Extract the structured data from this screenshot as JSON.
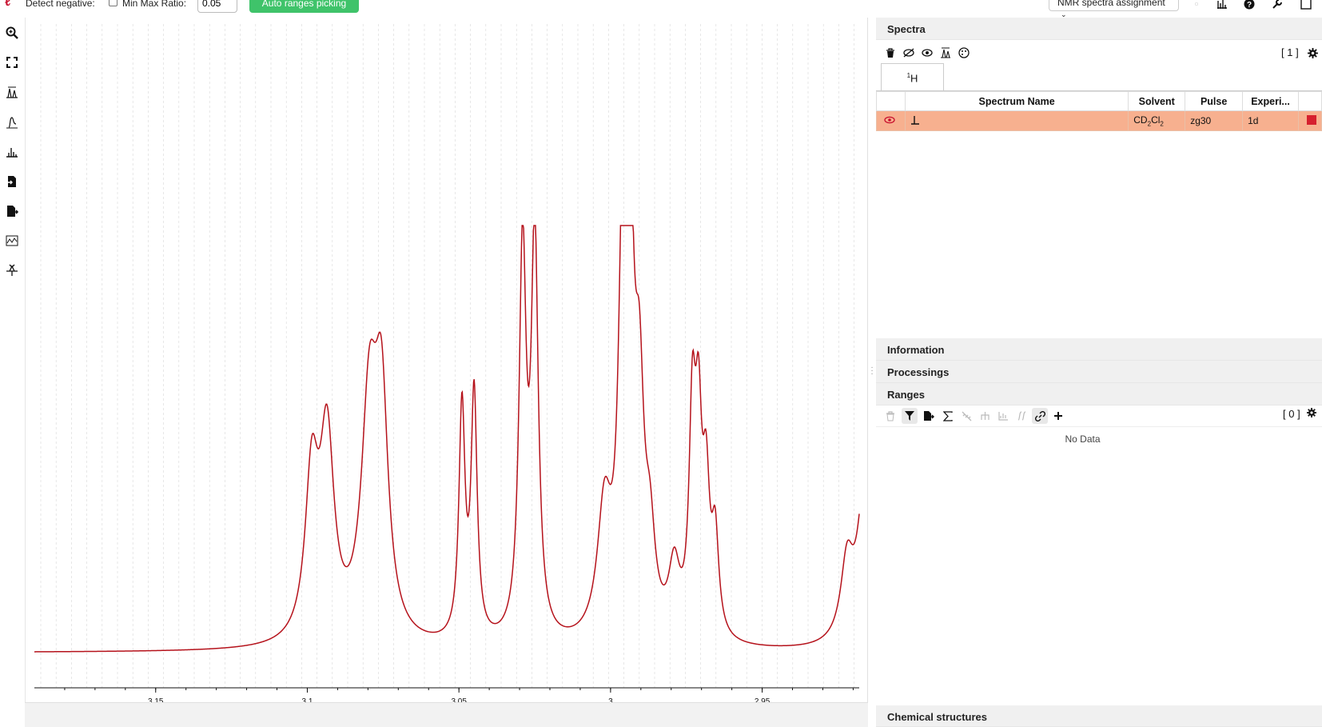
{
  "topbar": {
    "logo": "ℓ",
    "detect_negative_label": "Detect negative:",
    "min_max_ratio_label": "Min Max Ratio:",
    "min_max_ratio_value": "0.05",
    "auto_ranges_button": "Auto ranges picking",
    "assignment_select": "NMR spectra assignment"
  },
  "left_tools": [
    "zoom-tool",
    "full-screen",
    "peak-picking",
    "integral",
    "ranges",
    "import",
    "export",
    "baseline",
    "phase"
  ],
  "plot": {
    "x_ticks": [
      "3.15",
      "3.1",
      "3.05",
      "3",
      "2.95"
    ],
    "x_tick_values": [
      3.15,
      3.1,
      3.05,
      3.0,
      2.95
    ],
    "x_range": [
      3.19,
      2.918
    ],
    "line_color": "#b5121b"
  },
  "spectra": {
    "title": "Spectra",
    "count": "[ 1 ]",
    "tab_sup": "1",
    "tab_label": "H",
    "columns": [
      "Spectrum Name",
      "Solvent",
      "Pulse",
      "Experi..."
    ],
    "row": {
      "solvent_pre": "CD",
      "solvent_sub1": "2",
      "solvent_mid": "Cl",
      "solvent_sub2": "2",
      "pulse": "zg30",
      "experiment": "1d",
      "color": "#d6202e"
    }
  },
  "sections": {
    "information": "Information",
    "processings": "Processings",
    "ranges": "Ranges",
    "chemical_structures": "Chemical structures"
  },
  "ranges": {
    "count": "[ 0 ]",
    "no_data": "No Data"
  }
}
